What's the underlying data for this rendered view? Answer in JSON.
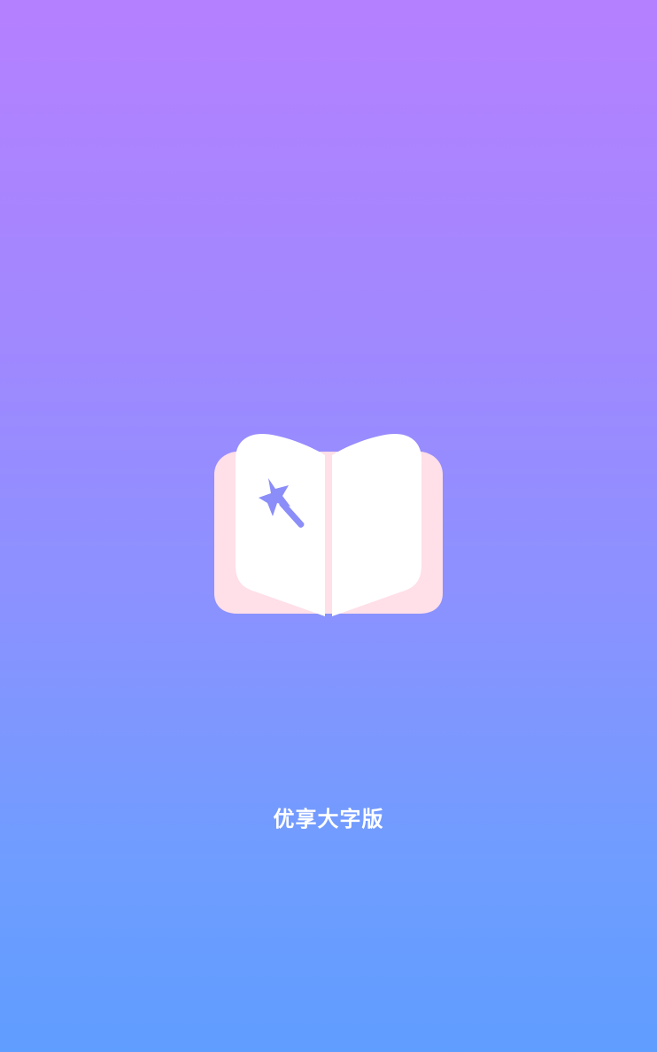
{
  "splash": {
    "app_name": "优享大字版",
    "logo_icon": "open-book-magic-wand-icon"
  },
  "colors": {
    "gradient_top": "#b580ff",
    "gradient_bottom": "#5f9dff",
    "book_pages": "#ffffff",
    "book_cover": "#ffdfe8",
    "wand": "#8b8df8"
  }
}
